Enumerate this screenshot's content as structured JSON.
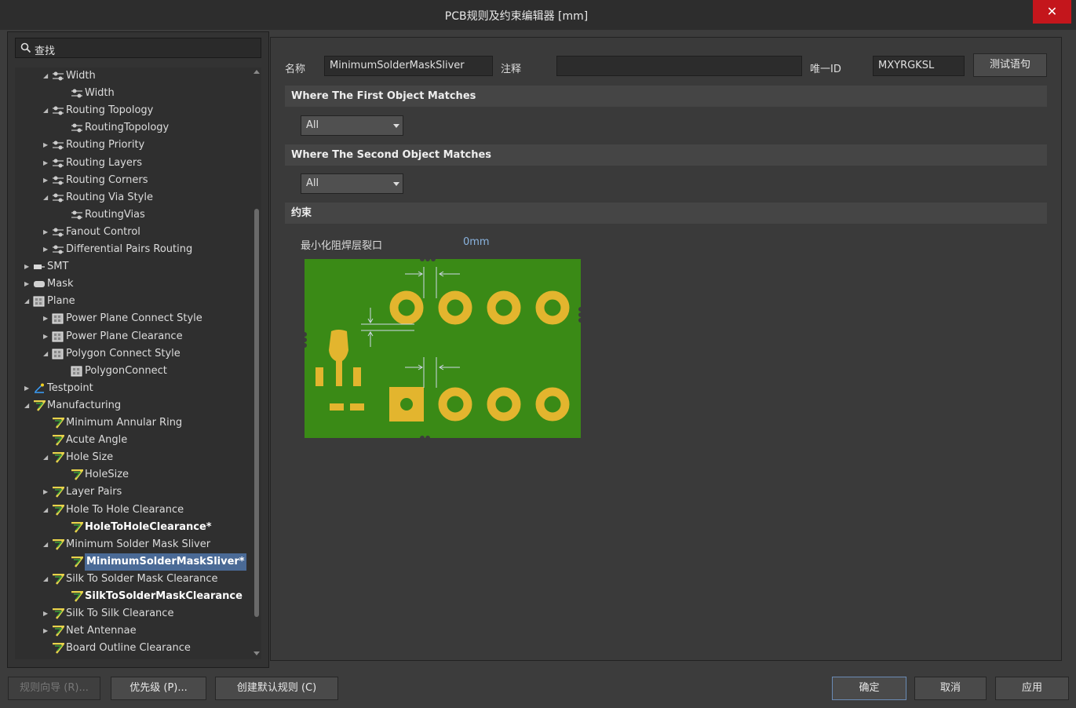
{
  "window": {
    "title": "PCB规则及约束编辑器 [mm]",
    "close": "✕"
  },
  "search": {
    "placeholder": "查找"
  },
  "tree": [
    {
      "label": "Width",
      "arrow": "◢",
      "icon": "routing",
      "depth": 2
    },
    {
      "label": "Width",
      "arrow": "",
      "icon": "routing",
      "depth": 3
    },
    {
      "label": "Routing Topology",
      "arrow": "◢",
      "icon": "routing",
      "depth": 2
    },
    {
      "label": "RoutingTopology",
      "arrow": "",
      "icon": "routing",
      "depth": 3
    },
    {
      "label": "Routing Priority",
      "arrow": "▶",
      "icon": "routing",
      "depth": 2
    },
    {
      "label": "Routing Layers",
      "arrow": "▶",
      "icon": "routing",
      "depth": 2
    },
    {
      "label": "Routing Corners",
      "arrow": "▶",
      "icon": "routing",
      "depth": 2
    },
    {
      "label": "Routing Via Style",
      "arrow": "◢",
      "icon": "routing",
      "depth": 2
    },
    {
      "label": "RoutingVias",
      "arrow": "",
      "icon": "routing",
      "depth": 3
    },
    {
      "label": "Fanout Control",
      "arrow": "▶",
      "icon": "routing",
      "depth": 2
    },
    {
      "label": "Differential Pairs Routing",
      "arrow": "▶",
      "icon": "routing",
      "depth": 2
    },
    {
      "label": "SMT",
      "arrow": "▶",
      "icon": "smt",
      "depth": 1
    },
    {
      "label": "Mask",
      "arrow": "▶",
      "icon": "mask",
      "depth": 1
    },
    {
      "label": "Plane",
      "arrow": "◢",
      "icon": "plane",
      "depth": 1
    },
    {
      "label": "Power Plane Connect Style",
      "arrow": "▶",
      "icon": "plane",
      "depth": 2
    },
    {
      "label": "Power Plane Clearance",
      "arrow": "▶",
      "icon": "plane",
      "depth": 2
    },
    {
      "label": "Polygon Connect Style",
      "arrow": "◢",
      "icon": "plane",
      "depth": 2
    },
    {
      "label": "PolygonConnect",
      "arrow": "",
      "icon": "plane",
      "depth": 3
    },
    {
      "label": "Testpoint",
      "arrow": "▶",
      "icon": "testpoint",
      "depth": 1
    },
    {
      "label": "Manufacturing",
      "arrow": "◢",
      "icon": "mfg",
      "depth": 1
    },
    {
      "label": "Minimum Annular Ring",
      "arrow": "",
      "icon": "mfg",
      "depth": 2
    },
    {
      "label": "Acute Angle",
      "arrow": "",
      "icon": "mfg",
      "depth": 2
    },
    {
      "label": "Hole Size",
      "arrow": "◢",
      "icon": "mfg",
      "depth": 2
    },
    {
      "label": "HoleSize",
      "arrow": "",
      "icon": "mfg",
      "depth": 3
    },
    {
      "label": "Layer Pairs",
      "arrow": "▶",
      "icon": "mfg",
      "depth": 2
    },
    {
      "label": "Hole To Hole Clearance",
      "arrow": "◢",
      "icon": "mfg",
      "depth": 2
    },
    {
      "label": "HoleToHoleClearance*",
      "arrow": "",
      "icon": "mfg",
      "depth": 3,
      "bold": true
    },
    {
      "label": "Minimum Solder Mask Sliver",
      "arrow": "◢",
      "icon": "mfg",
      "depth": 2
    },
    {
      "label": "MinimumSolderMaskSliver*",
      "arrow": "",
      "icon": "mfg",
      "depth": 3,
      "selected": true
    },
    {
      "label": "Silk To Solder Mask Clearance",
      "arrow": "◢",
      "icon": "mfg",
      "depth": 2
    },
    {
      "label": "SilkToSolderMaskClearance",
      "arrow": "",
      "icon": "mfg",
      "depth": 3,
      "bold": true
    },
    {
      "label": "Silk To Silk Clearance",
      "arrow": "▶",
      "icon": "mfg",
      "depth": 2
    },
    {
      "label": "Net Antennae",
      "arrow": "▶",
      "icon": "mfg",
      "depth": 2
    },
    {
      "label": "Board Outline Clearance",
      "arrow": "",
      "icon": "mfg",
      "depth": 2
    }
  ],
  "rule": {
    "name_label": "名称",
    "name_value": "MinimumSolderMaskSliver",
    "comment_label": "注释",
    "comment_value": "",
    "id_label": "唯一ID",
    "id_value": "MXYRGKSL",
    "test_button": "测试语句"
  },
  "first_match": {
    "header": "Where The First Object Matches",
    "value": "All"
  },
  "second_match": {
    "header": "Where The Second Object Matches",
    "value": "All"
  },
  "constraints": {
    "header": "约束",
    "param_label": "最小化阻焊层裂口",
    "param_value": "0mm"
  },
  "bottom": {
    "wizard": "规则向导 (R)...",
    "priority": "优先级 (P)...",
    "default_rules": "创建默认规则 (C)",
    "ok": "确定",
    "cancel": "取消",
    "apply": "应用"
  },
  "colors": {
    "board": "#3a8a16",
    "copper": "#e3b52e",
    "accent": "#c4161c"
  }
}
